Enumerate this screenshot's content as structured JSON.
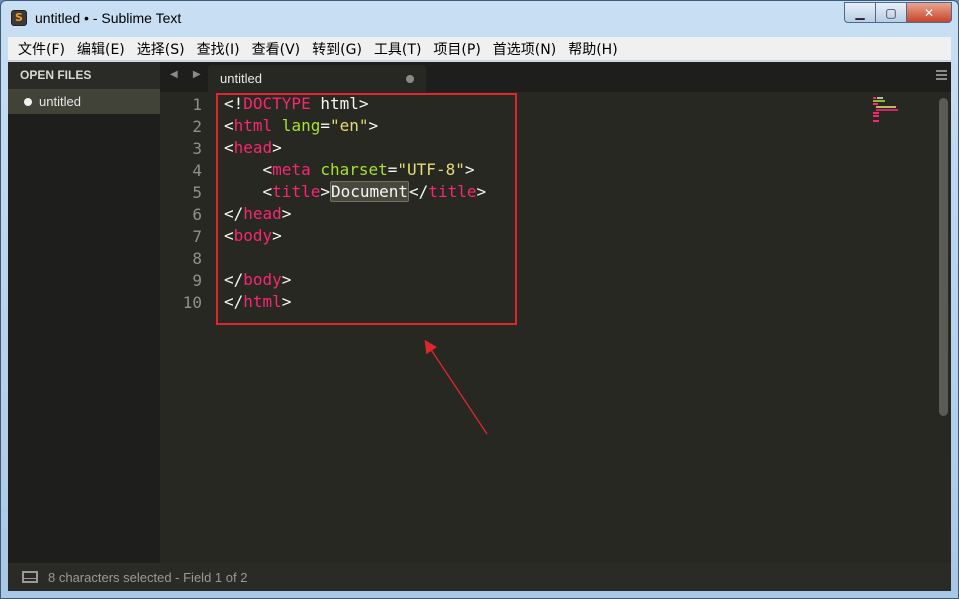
{
  "window": {
    "title": "untitled • - Sublime Text",
    "app_icon_letter": "S",
    "controls": {
      "minimize": "▁",
      "maximize": "▢",
      "close": "✕"
    }
  },
  "menubar": {
    "items": [
      {
        "label": "文件(F)"
      },
      {
        "label": "编辑(E)"
      },
      {
        "label": "选择(S)"
      },
      {
        "label": "查找(I)"
      },
      {
        "label": "查看(V)"
      },
      {
        "label": "转到(G)"
      },
      {
        "label": "工具(T)"
      },
      {
        "label": "项目(P)"
      },
      {
        "label": "首选项(N)"
      },
      {
        "label": "帮助(H)"
      }
    ]
  },
  "sidebar": {
    "header": "OPEN FILES",
    "files": [
      {
        "name": "untitled",
        "modified": true
      }
    ]
  },
  "tabs": {
    "nav": "◀ ▶",
    "items": [
      {
        "label": "untitled",
        "modified": true
      }
    ]
  },
  "editor": {
    "active_line": 5,
    "lines": [
      {
        "num": "1"
      },
      {
        "num": "2"
      },
      {
        "num": "3"
      },
      {
        "num": "4"
      },
      {
        "num": "5"
      },
      {
        "num": "6"
      },
      {
        "num": "7"
      },
      {
        "num": "8"
      },
      {
        "num": "9"
      },
      {
        "num": "10"
      }
    ],
    "code": {
      "l1": {
        "open": "<!",
        "tag": "DOCTYPE",
        "rest": " html",
        "close": ">"
      },
      "l2": {
        "open": "<",
        "tag": "html",
        "attr": " lang",
        "eq": "=",
        "val": "\"en\"",
        "close": ">"
      },
      "l3": {
        "open": "<",
        "tag": "head",
        "close": ">"
      },
      "l4": {
        "indent": "    ",
        "open": "<",
        "tag": "meta",
        "attr": " charset",
        "eq": "=",
        "val": "\"UTF-8\"",
        "close": ">"
      },
      "l5": {
        "indent": "    ",
        "open": "<",
        "tag": "title",
        "close": ">",
        "text": "Document",
        "open2": "</",
        "tag2": "title",
        "close2": ">"
      },
      "l6": {
        "open": "</",
        "tag": "head",
        "close": ">"
      },
      "l7": {
        "open": "<",
        "tag": "body",
        "close": ">"
      },
      "l9": {
        "open": "</",
        "tag": "body",
        "close": ">"
      },
      "l10": {
        "open": "</",
        "tag": "html",
        "close": ">"
      }
    }
  },
  "statusbar": {
    "text": "8 characters selected - Field 1 of 2"
  },
  "colors": {
    "tag": "#f92672",
    "attribute": "#a6e22e",
    "string": "#e6db74",
    "background": "#272822",
    "annotation": "#e0262d"
  }
}
